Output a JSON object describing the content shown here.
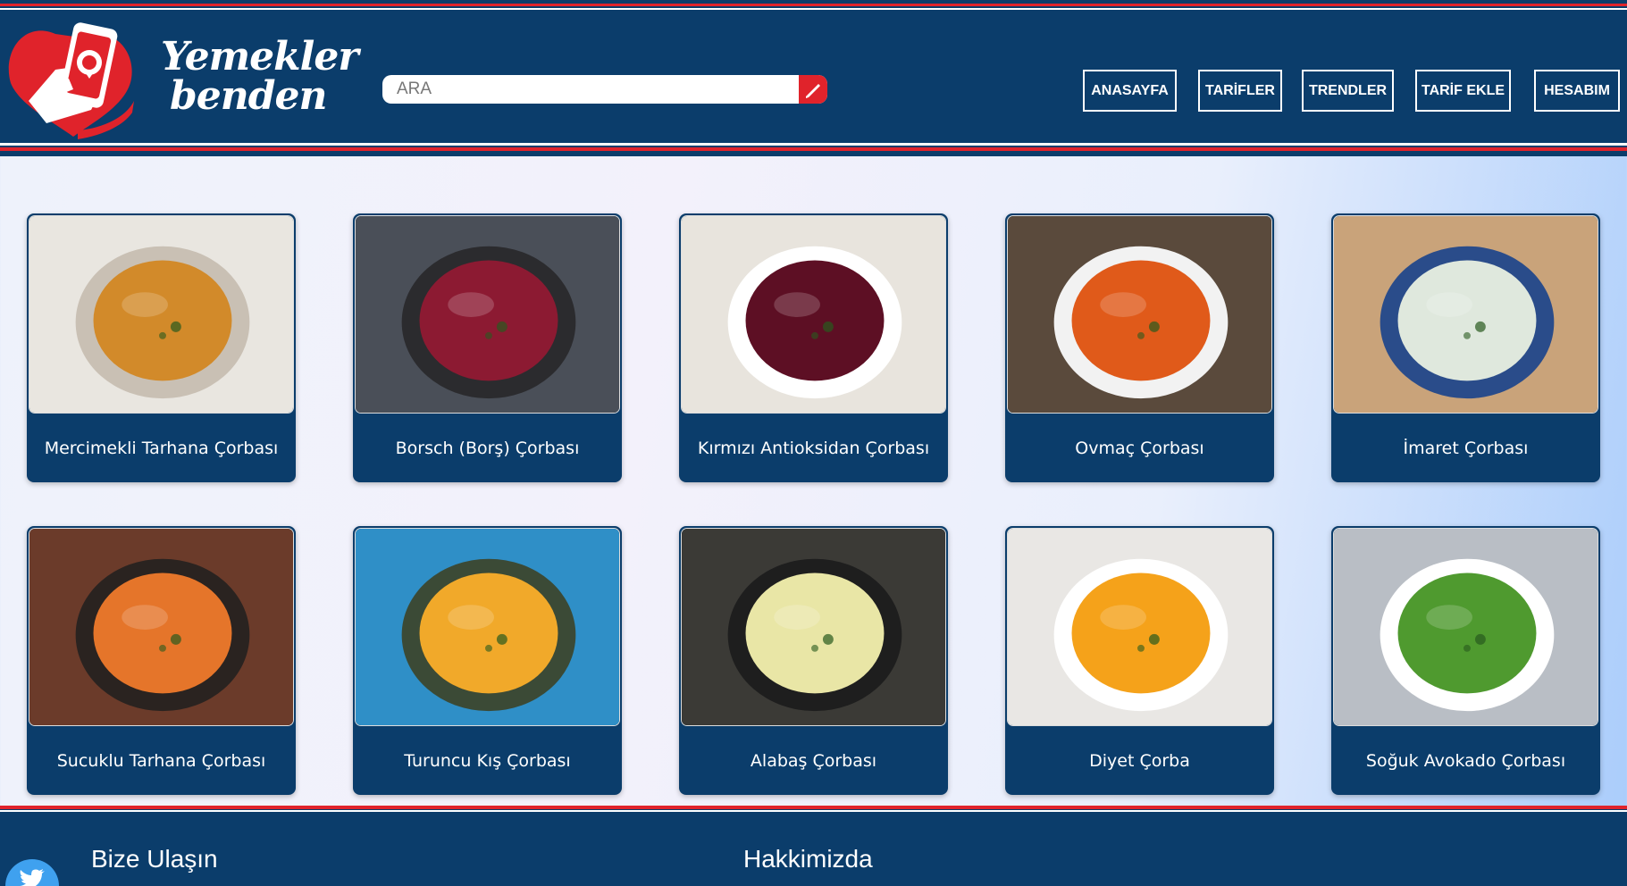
{
  "header": {
    "logo_line1": "Yemekler",
    "logo_line2": "benden",
    "search_placeholder": "ARA",
    "nav": [
      {
        "label": "ANASAYFA"
      },
      {
        "label": "TARİFLER"
      },
      {
        "label": "TRENDLER"
      },
      {
        "label": "TARİF EKLE"
      },
      {
        "label": "HESABIM"
      }
    ]
  },
  "recipes": [
    {
      "title": "Mercimekli Tarhana Çorbası",
      "soup_color": "#d28a2a",
      "bg_color": "#e9e6e0",
      "bowl_color": "#c9c0b4"
    },
    {
      "title": "Borsch (Borş) Çorbası",
      "soup_color": "#8c1a32",
      "bg_color": "#4a4f58",
      "bowl_color": "#2b2b2e"
    },
    {
      "title": "Kırmızı Antioksidan Çorbası",
      "soup_color": "#5d0f24",
      "bg_color": "#e8e4dd",
      "bowl_color": "#ffffff"
    },
    {
      "title": "Ovmaç Çorbası",
      "soup_color": "#e05a1a",
      "bg_color": "#5a4a3c",
      "bowl_color": "#f2f2f2"
    },
    {
      "title": "İmaret Çorbası",
      "soup_color": "#dfe8dd",
      "bg_color": "#c9a37a",
      "bowl_color": "#2a4c8a"
    },
    {
      "title": "Sucuklu Tarhana Çorbası",
      "soup_color": "#e5752a",
      "bg_color": "#6b3b2a",
      "bowl_color": "#2a2320"
    },
    {
      "title": "Turuncu Kış Çorbası",
      "soup_color": "#f1a92a",
      "bg_color": "#2f8fc7",
      "bowl_color": "#3b4a36"
    },
    {
      "title": "Alabaş Çorbası",
      "soup_color": "#e9e6a6",
      "bg_color": "#3b3a36",
      "bowl_color": "#1e1e1e"
    },
    {
      "title": "Diyet Çorba",
      "soup_color": "#f5a21a",
      "bg_color": "#e9e7e4",
      "bowl_color": "#ffffff"
    },
    {
      "title": "Soğuk Avokado Çorbası",
      "soup_color": "#4f9a2f",
      "bg_color": "#b9bec5",
      "bowl_color": "#ffffff"
    }
  ],
  "footer": {
    "contact_title": "Bize Ulaşın",
    "about_title": "Hakkimizda"
  },
  "colors": {
    "navy": "#0b3d6b",
    "accent_red": "#e0232b"
  }
}
